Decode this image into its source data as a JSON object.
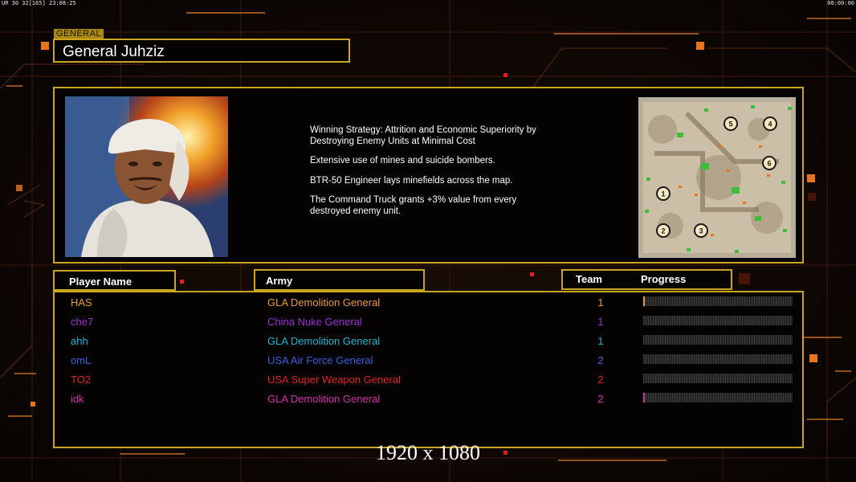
{
  "status": {
    "left": "UR 30 32[165] 23:08:25",
    "right": "00:00:00"
  },
  "general": {
    "tag": "GENERAL",
    "name": "General Juhziz"
  },
  "portrait": {
    "icon": "general-portrait"
  },
  "description": [
    "Winning Strategy: Attrition and Economic Superiority by\n Destroying Enemy Units at Minimal Cost",
    "Extensive use of mines and suicide bombers.",
    "BTR-50 Engineer lays minefields across the map.",
    "The Command Truck grants +3% value from every\n destroyed enemy unit."
  ],
  "map": {
    "start_positions": [
      "1",
      "2",
      "3",
      "4",
      "5",
      "6"
    ]
  },
  "headers": {
    "player_name": "Player Name",
    "army": "Army",
    "team": "Team",
    "progress": "Progress"
  },
  "players": [
    {
      "name": "HAS",
      "army": "GLA Demolition General",
      "team": "1",
      "color": "#e89a3c",
      "progress": 0.01
    },
    {
      "name": "che7",
      "army": "China Nuke General",
      "team": "1",
      "color": "#9b2fd6",
      "progress": 0
    },
    {
      "name": "ahh",
      "army": "GLA Demolition General",
      "team": "1",
      "color": "#1fb5d4",
      "progress": 0
    },
    {
      "name": "omL",
      "army": "USA Air Force General",
      "team": "2",
      "color": "#3b5fe0",
      "progress": 0
    },
    {
      "name": "TO2",
      "army": "USA Super Weapon General",
      "team": "2",
      "color": "#e0241f",
      "progress": 0
    },
    {
      "name": "idk",
      "army": "GLA Demolition General",
      "team": "2",
      "color": "#d42fae",
      "progress": 0.01
    }
  ],
  "resolution": "1920 x 1080",
  "colors": {
    "accent": "#c9a521",
    "orange": "#e8741c"
  }
}
